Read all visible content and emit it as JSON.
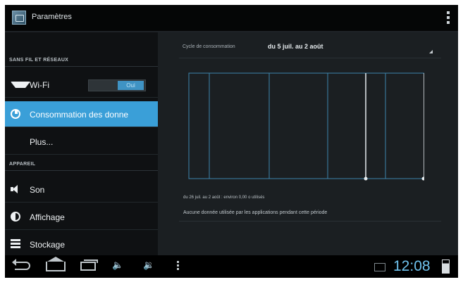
{
  "action_bar": {
    "title": "Paramètres",
    "app_icon": "settings-app-icon",
    "overflow_icon": "overflow-menu-icon"
  },
  "sidebar": {
    "section_wireless": "SANS FIL ET RÉSEAUX",
    "section_device": "APPAREIL",
    "items": [
      {
        "label": "Wi-Fi",
        "icon": "wifi-icon",
        "toggle": "Oui"
      },
      {
        "label": "Consommation des donne",
        "icon": "data-usage-icon",
        "selected": true
      },
      {
        "label": "Plus..."
      },
      {
        "label": "Son",
        "icon": "sound-icon"
      },
      {
        "label": "Affichage",
        "icon": "display-icon"
      },
      {
        "label": "Stockage",
        "icon": "storage-icon"
      }
    ]
  },
  "data_usage": {
    "cycle_label": "Cycle de consommation",
    "cycle_value": "du 5 juil. au 2 août",
    "range_text": "du 26 juil. au 2 août : environ 0,00 o utilisés",
    "no_apps_text": "Aucune donnée utilisée par les applications pendant cette période"
  },
  "nav_bar": {
    "clock": "12:08",
    "vol_down_glyph": "🔈",
    "vol_up_glyph": "🔉"
  },
  "colors": {
    "accent": "#3a9fd8",
    "clock": "#6fc2ee",
    "chart_line": "#3c86ad"
  }
}
